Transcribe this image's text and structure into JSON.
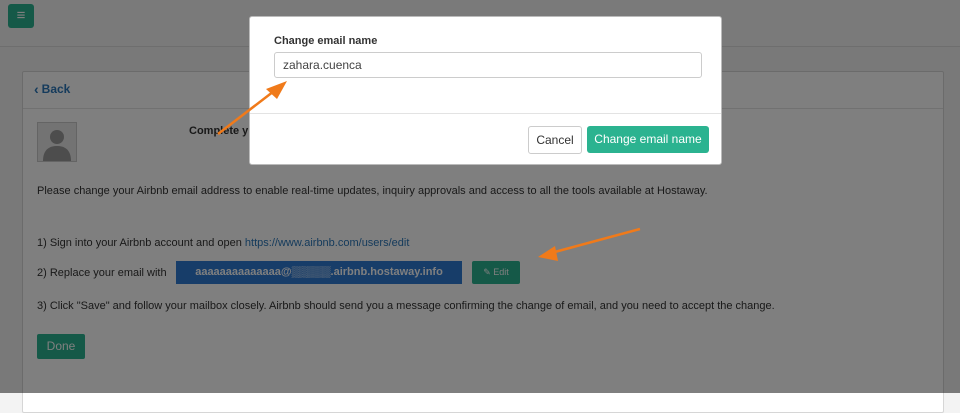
{
  "topbar": {
    "menu_icon": "hamburger-icon",
    "menu_glyph": "≡"
  },
  "panel": {
    "back_icon": "chevron-left-icon",
    "back_label": "Back",
    "avatar_icon": "user-avatar-icon",
    "complete_text": "Complete y",
    "intro_text": "Please change your Airbnb email address to enable real-time updates, inquiry approvals and access to all the tools available at Hostaway.",
    "step1_prefix": "1) Sign into your Airbnb account and open ",
    "step1_link": "https://www.airbnb.com/users/edit",
    "step2_label": "2) Replace your email with",
    "email_value": "aaaaaaaaaaaaaa@▒▒▒▒▒.airbnb.hostaway.info",
    "edit_icon": "edit-icon",
    "edit_label": "Edit",
    "step3_text": "3) Click \"Save\" and follow your mailbox closely. Airbnb should send you a message confirming the change of email, and you need to accept the change.",
    "done_label": "Done"
  },
  "modal": {
    "field_label": "Change email name",
    "input_value": "zahara.cuenca",
    "cancel_label": "Cancel",
    "confirm_label": "Change email name"
  },
  "colors": {
    "accent": "#2bb390",
    "link": "#2a76b8",
    "email_box": "#2f7bd3",
    "annotation_arrow": "#f07a1a"
  }
}
